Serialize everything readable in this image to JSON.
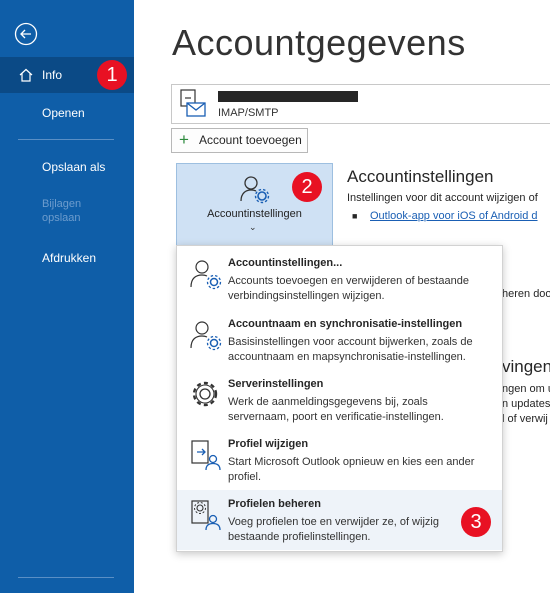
{
  "sidebar": {
    "items": [
      {
        "label": "Info"
      },
      {
        "label": "Openen"
      },
      {
        "label": "Opslaan als"
      },
      {
        "label": "Bijlagen\nopslaan"
      },
      {
        "label": "Afdrukken"
      }
    ]
  },
  "page": {
    "title": "Accountgegevens"
  },
  "account": {
    "type": "IMAP/SMTP"
  },
  "add_account_label": "Account toevoegen",
  "account_settings_button": {
    "label": "Accountinstellingen",
    "chevron": "⌄"
  },
  "section": {
    "title": "Accountinstellingen",
    "description": "Instellingen voor dit account wijzigen of",
    "link": "Outlook-app voor iOS of Android d"
  },
  "background_fragments": [
    "heren doo",
    "vingen",
    "ngen om u",
    "n updates",
    "l of verwij"
  ],
  "menu": {
    "items": [
      {
        "title": "Accountinstellingen...",
        "desc": "Accounts toevoegen en verwijderen of bestaande verbindingsinstellingen wijzigen."
      },
      {
        "title": "Accountnaam en synchronisatie-instellingen",
        "desc": "Basisinstellingen voor account bijwerken, zoals de accountnaam en mapsynchronisatie-instellingen."
      },
      {
        "title": "Serverinstellingen",
        "desc": "Werk de aanmeldingsgegevens bij, zoals servernaam, poort en verificatie-instellingen."
      },
      {
        "title": "Profiel wijzigen",
        "desc": "Start  Microsoft Outlook opnieuw en kies een ander profiel."
      },
      {
        "title": "Profielen beheren",
        "desc": "Voeg profielen toe en verwijder ze, of wijzig bestaande profielinstellingen."
      }
    ]
  },
  "annotations": [
    "1",
    "2",
    "3"
  ],
  "colors": {
    "sidebar": "#0f5ea8",
    "sidebar_selected": "#0b4a86",
    "badge": "#e81123",
    "button_selected": "#cfe1f4",
    "link": "#1a5fb4"
  },
  "icons": [
    "back-arrow-icon",
    "home-icon",
    "mail-account-icon",
    "plus-icon",
    "account-settings-icon",
    "user-gear-icon",
    "gear-icon",
    "profile-switch-icon",
    "profile-manage-icon"
  ]
}
